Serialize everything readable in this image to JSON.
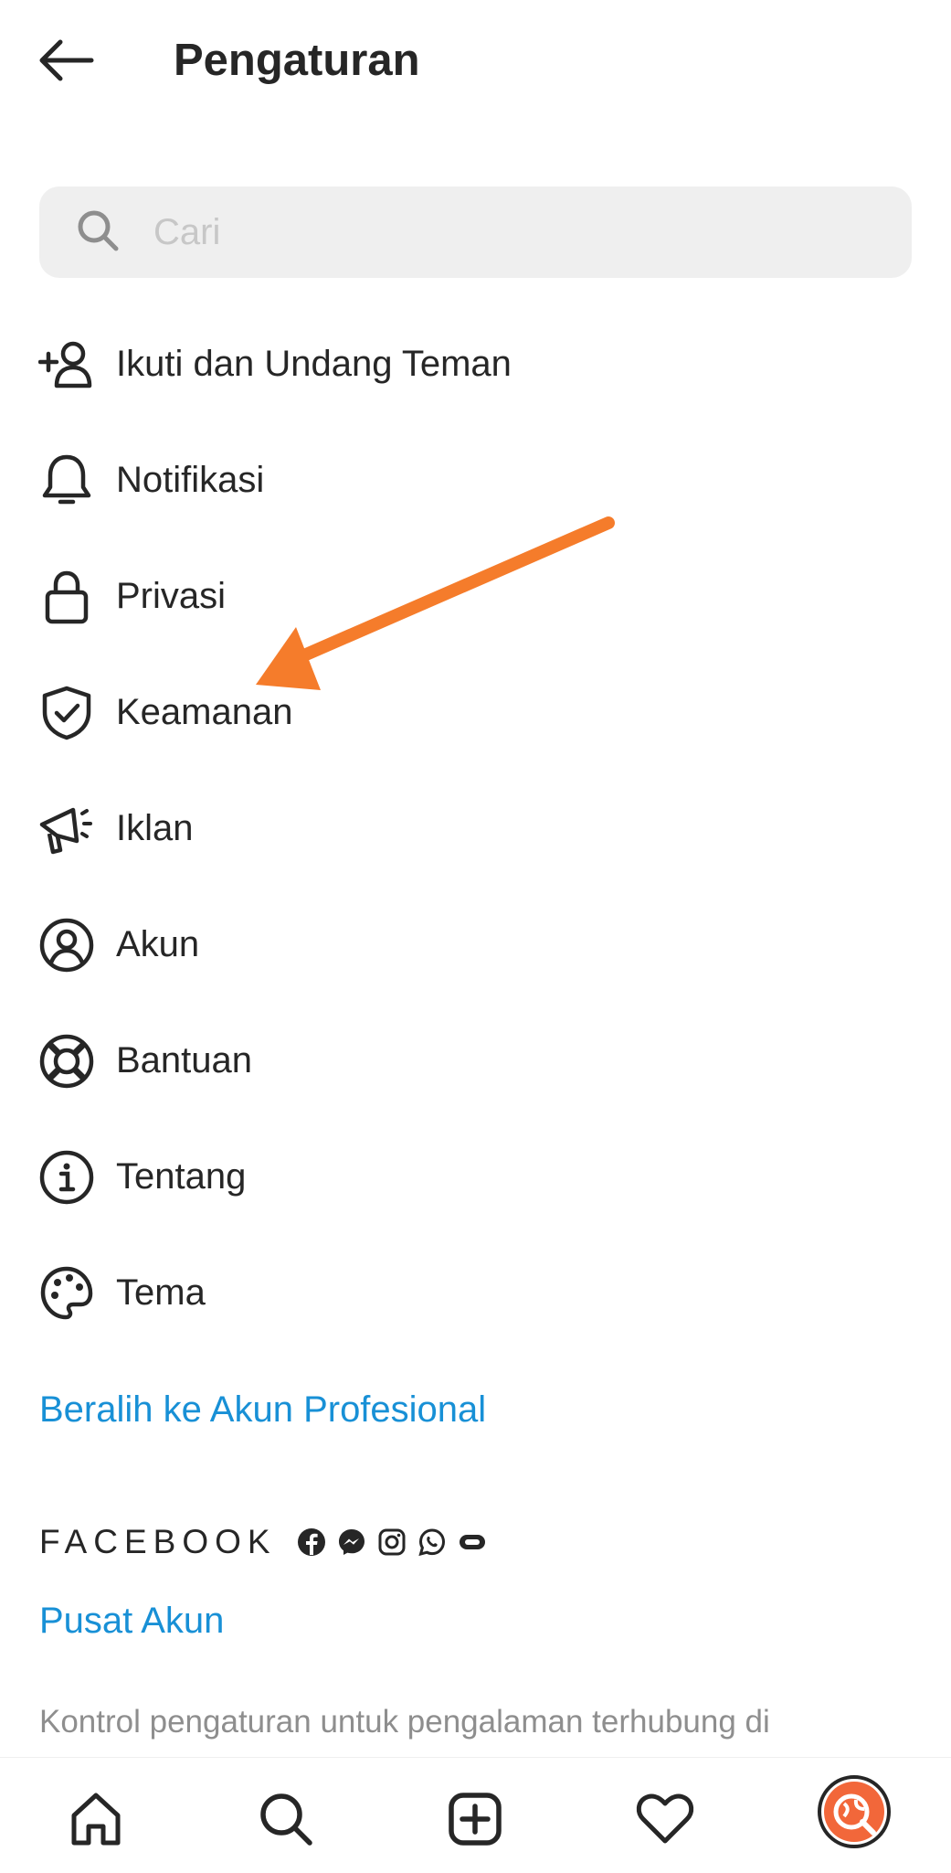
{
  "header": {
    "title": "Pengaturan"
  },
  "search": {
    "placeholder": "Cari"
  },
  "menu": [
    {
      "label": "Ikuti dan Undang Teman",
      "icon": "add-person-icon"
    },
    {
      "label": "Notifikasi",
      "icon": "bell-icon"
    },
    {
      "label": "Privasi",
      "icon": "lock-icon"
    },
    {
      "label": "Keamanan",
      "icon": "shield-check-icon"
    },
    {
      "label": "Iklan",
      "icon": "megaphone-icon"
    },
    {
      "label": "Akun",
      "icon": "account-circle-icon"
    },
    {
      "label": "Bantuan",
      "icon": "lifebuoy-icon"
    },
    {
      "label": "Tentang",
      "icon": "info-icon"
    },
    {
      "label": "Tema",
      "icon": "palette-icon"
    }
  ],
  "professional_link": "Beralih ke Akun Profesional",
  "facebook": {
    "label": "FACEBOOK",
    "icons": [
      "facebook-icon",
      "messenger-icon",
      "instagram-icon",
      "whatsapp-icon",
      "portal-icon"
    ]
  },
  "accounts_center_link": "Pusat Akun",
  "accounts_center_desc": "Kontrol pengaturan untuk pengalaman terhubung di",
  "bottom_nav": [
    "home-icon",
    "search-icon",
    "new-post-icon",
    "activity-heart-icon",
    "profile-avatar"
  ],
  "colors": {
    "link": "#1890d6",
    "annotation_arrow": "#f57c2b",
    "search_bg": "#efefef",
    "text": "#262626",
    "muted": "#8e8e8e"
  }
}
